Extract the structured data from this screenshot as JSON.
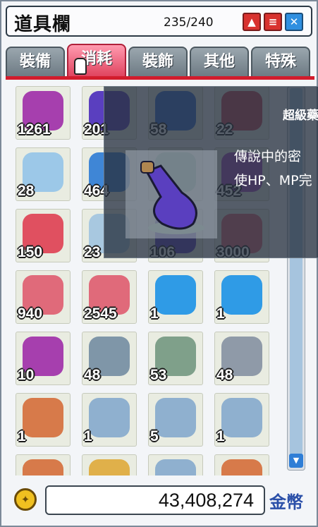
{
  "window": {
    "title": "道具欄",
    "slot_count": "235/240"
  },
  "title_buttons": [
    "up",
    "menu",
    "close"
  ],
  "tabs": [
    {
      "label": "裝備",
      "active": false
    },
    {
      "label": "消耗",
      "active": true
    },
    {
      "label": "裝飾",
      "active": false
    },
    {
      "label": "其他",
      "active": false
    },
    {
      "label": "特殊",
      "active": false
    }
  ],
  "slots": [
    {
      "qty": "1261",
      "icon": "potion-green-purple-icon",
      "color": "#a63fae"
    },
    {
      "qty": "201",
      "icon": "potion-blue-purple-icon",
      "color": "#5a3fbf"
    },
    {
      "qty": "58",
      "icon": "potion-blue-icon",
      "color": "#3a6fcf"
    },
    {
      "qty": "22",
      "icon": "potion-red-gourd-icon",
      "color": "#c24a5a"
    },
    {
      "qty": "28",
      "icon": "ice-cream-icon",
      "color": "#9cc8e8"
    },
    {
      "qty": "464",
      "icon": "blue-flask-icon",
      "color": "#3f86d6"
    },
    {
      "qty": "",
      "icon": "potion-green-icon",
      "color": "#8ec7a8"
    },
    {
      "qty": "452",
      "icon": "potion-purple-icon",
      "color": "#a64fc0"
    },
    {
      "qty": "150",
      "icon": "red-potion-icon",
      "color": "#e05060"
    },
    {
      "qty": "23",
      "icon": "water-bottle-icon",
      "color": "#a8c8e0"
    },
    {
      "qty": "106",
      "icon": "potion-blue-purple-icon",
      "color": "#5a3fbf"
    },
    {
      "qty": "3000",
      "icon": "meat-slice-icon",
      "color": "#e06a7a"
    },
    {
      "qty": "940",
      "icon": "meat-slice-icon",
      "color": "#e06a7a"
    },
    {
      "qty": "2545",
      "icon": "meat-slice-icon",
      "color": "#e06a7a"
    },
    {
      "qty": "1",
      "icon": "maple-leaf-icon",
      "color": "#2f9be6"
    },
    {
      "qty": "1",
      "icon": "maple-leaf-icon",
      "color": "#2f9be6"
    },
    {
      "qty": "10",
      "icon": "potion-green-purple-icon",
      "color": "#a63fae"
    },
    {
      "qty": "48",
      "icon": "scroll-gray-icon",
      "color": "#7f96a8"
    },
    {
      "qty": "53",
      "icon": "scroll-green-icon",
      "color": "#7fa08a"
    },
    {
      "qty": "48",
      "icon": "scroll-gray-icon",
      "color": "#8f9aa8"
    },
    {
      "qty": "1",
      "icon": "scroll-orange-icon",
      "color": "#d77a4a"
    },
    {
      "qty": "1",
      "icon": "scroll-blue-icon",
      "color": "#8fb0cf"
    },
    {
      "qty": "5",
      "icon": "scroll-blue-icon",
      "color": "#8fb0cf"
    },
    {
      "qty": "1",
      "icon": "scroll-blue-icon",
      "color": "#8fb0cf"
    },
    {
      "qty": "",
      "icon": "scroll-orange-icon",
      "color": "#d77a4a"
    },
    {
      "qty": "",
      "icon": "scroll-yellow-icon",
      "color": "#e0b04a"
    },
    {
      "qty": "",
      "icon": "scroll-blue-icon",
      "color": "#8fb0cf"
    },
    {
      "qty": "",
      "icon": "scroll-orange-icon",
      "color": "#d77a4a"
    }
  ],
  "tooltip": {
    "name": "超級藥",
    "desc_line1": "傳說中的密",
    "desc_line2": "使HP、MP完"
  },
  "footer": {
    "money": "43,408,274",
    "unit": "金幣",
    "coin_symbol": "✦"
  }
}
